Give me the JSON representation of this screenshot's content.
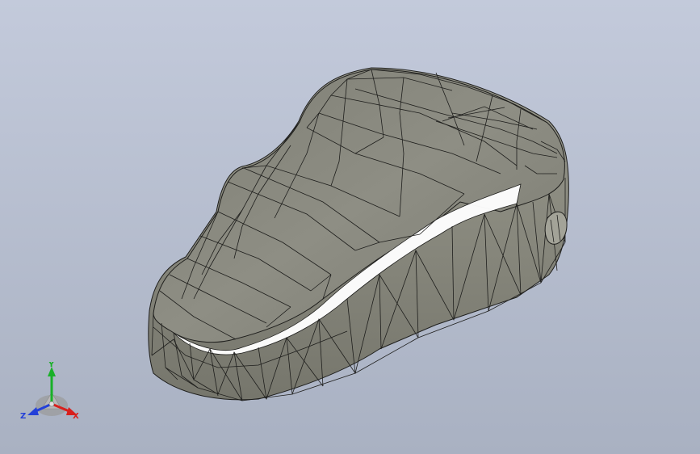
{
  "viewport": {
    "background_top": "#c3cadb",
    "background_bottom": "#a9b1c2"
  },
  "model": {
    "face_color": "#8c8c82",
    "edge_color": "#1e1e1c",
    "highlight_color": "#ffffff"
  },
  "triad": {
    "y_label": "Y",
    "x_label": "X",
    "z_label": "Z",
    "y_color": "#19b028",
    "x_color": "#d8201c",
    "z_color": "#2440d8"
  }
}
